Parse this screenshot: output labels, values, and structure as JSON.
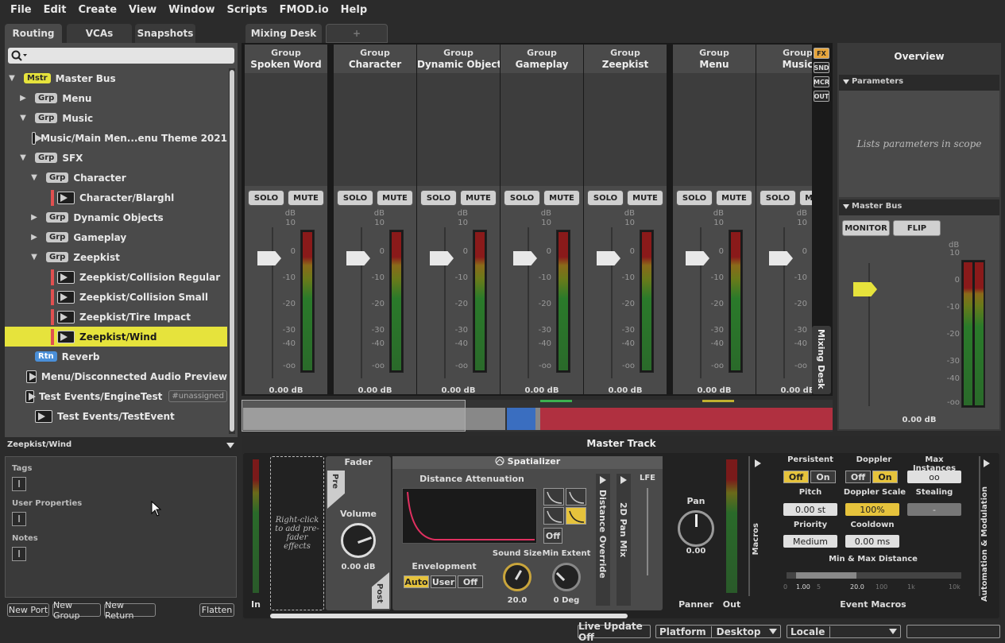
{
  "menubar": {
    "items": [
      "File",
      "Edit",
      "Create",
      "View",
      "Window",
      "Scripts",
      "FMOD.io",
      "Help"
    ]
  },
  "left_tabs": [
    "Routing",
    "VCAs",
    "Snapshots"
  ],
  "desk_tabs": {
    "active": "Mixing Desk",
    "add": "+"
  },
  "tree": [
    {
      "indent": 0,
      "twisty": "open",
      "badge": "Mstr",
      "label": "Master Bus"
    },
    {
      "indent": 1,
      "twisty": "closed",
      "badge": "Grp",
      "label": "Menu"
    },
    {
      "indent": 1,
      "twisty": "open",
      "badge": "Grp",
      "label": "Music"
    },
    {
      "indent": 2,
      "twisty": "",
      "event": true,
      "label": "Music/Main Men...enu Theme 2021"
    },
    {
      "indent": 1,
      "twisty": "open",
      "badge": "Grp",
      "label": "SFX"
    },
    {
      "indent": 2,
      "twisty": "open",
      "badge": "Grp",
      "label": "Character"
    },
    {
      "indent": 3,
      "twisty": "",
      "event": true,
      "red": true,
      "label": "Character/Blarghl"
    },
    {
      "indent": 2,
      "twisty": "closed",
      "badge": "Grp",
      "label": "Dynamic Objects"
    },
    {
      "indent": 2,
      "twisty": "closed",
      "badge": "Grp",
      "label": "Gameplay"
    },
    {
      "indent": 2,
      "twisty": "open",
      "badge": "Grp",
      "label": "Zeepkist"
    },
    {
      "indent": 3,
      "twisty": "",
      "event": true,
      "red": true,
      "label": "Zeepkist/Collision Regular"
    },
    {
      "indent": 3,
      "twisty": "",
      "event": true,
      "red": true,
      "label": "Zeepkist/Collision Small"
    },
    {
      "indent": 3,
      "twisty": "",
      "event": true,
      "red": true,
      "label": "Zeepkist/Tire Impact"
    },
    {
      "indent": 3,
      "twisty": "",
      "event": true,
      "red": true,
      "selected": true,
      "label": "Zeepkist/Wind"
    },
    {
      "indent": 1,
      "twisty": "",
      "badge": "Rtn",
      "label": "Reverb"
    },
    {
      "indent": 1,
      "twisty": "",
      "event": true,
      "label": "Menu/Disconnected Audio Preview"
    },
    {
      "indent": 1,
      "twisty": "",
      "event": true,
      "label": "Test Events/EngineTest",
      "tag": "#unassigned"
    },
    {
      "indent": 1,
      "twisty": "",
      "event": true,
      "label": "Test Events/TestEvent"
    }
  ],
  "props": {
    "title": "Zeepkist/Wind",
    "tags": "Tags",
    "user_properties": "User Properties",
    "notes": "Notes",
    "cursor": "I"
  },
  "bottom_buttons": {
    "new_port": "New Port",
    "new_group": "New Group",
    "new_return": "New Return",
    "flatten": "Flatten"
  },
  "strips": [
    {
      "group": "Group",
      "name": "Spoken Word",
      "db": "0.00 dB"
    },
    {
      "group": "Group",
      "name": "Character",
      "db": "0.00 dB"
    },
    {
      "group": "Group",
      "name": "Dynamic Objects",
      "db": "0.00 dB"
    },
    {
      "group": "Group",
      "name": "Gameplay",
      "db": "0.00 dB"
    },
    {
      "group": "Group",
      "name": "Zeepkist",
      "db": "0.00 dB"
    },
    {
      "group": "Group",
      "name": "Menu",
      "db": "0.00 dB"
    },
    {
      "group": "Group",
      "name": "Music",
      "db": "0.00 dB"
    }
  ],
  "strip_labels": {
    "solo": "SOLO",
    "mute": "MUTE",
    "db": "dB",
    "scale": [
      "10",
      "0",
      "-10",
      "-20",
      "-30",
      "-40",
      "-oo"
    ]
  },
  "side_tabs": [
    "FX",
    "SND",
    "MCR",
    "OUT"
  ],
  "mixing_desk_vertical": "Mixing Desk",
  "overview": {
    "title": "Overview",
    "parameters": "Parameters",
    "params_note": "Lists parameters in scope",
    "master_bus": "Master Bus",
    "monitor": "MONITOR",
    "flip": "FLIP",
    "db": "dB",
    "scale": [
      "10",
      "0",
      "-10",
      "-20",
      "-30",
      "-40",
      "-oo"
    ],
    "value": "0.00 dB"
  },
  "master_track": {
    "title": "Master Track",
    "in": "In",
    "out": "Out",
    "prefader_note": "Right-click to add pre-fader effects",
    "fader": "Fader",
    "pre": "Pre",
    "post": "Post",
    "volume": "Volume",
    "volume_value": "0.00 dB",
    "spatializer": "Spatializer",
    "distance_attenuation": "Distance Attenuation",
    "off": "Off",
    "envelopment": "Envelopment",
    "env_options": [
      "Auto",
      "User",
      "Off"
    ],
    "sound_size": "Sound Size",
    "sound_size_value": "20.0",
    "min_extent": "Min Extent",
    "min_extent_value": "0 Deg",
    "distance_override": "Distance Override",
    "pan_mix": "2D Pan Mix",
    "lfe": "LFE",
    "pan": "Pan",
    "pan_value": "0.00",
    "panner": "Panner",
    "macros": "Macros",
    "persistent": "Persistent",
    "persistent_opts": [
      "Off",
      "On"
    ],
    "doppler": "Doppler",
    "doppler_opts": [
      "Off",
      "On"
    ],
    "max_instances": "Max Instances",
    "max_instances_value": "oo",
    "pitch": "Pitch",
    "pitch_value": "0.00 st",
    "doppler_scale": "Doppler Scale",
    "doppler_scale_value": "100%",
    "stealing": "Stealing",
    "stealing_value": "-",
    "priority": "Priority",
    "priority_value": "Medium",
    "cooldown": "Cooldown",
    "cooldown_value": "0.00 ms",
    "min_max_distance": "Min & Max Distance",
    "dist_ticks": [
      "0",
      "1.00",
      "5",
      "20.0",
      "100",
      "1k",
      "10k"
    ],
    "event_macros": "Event Macros",
    "automation": "Automation & Modulation"
  },
  "status": {
    "live_update": "Live Update Off",
    "platform_label": "Platform",
    "platform_value": "Desktop",
    "locale_label": "Locale",
    "locale_value": ""
  }
}
